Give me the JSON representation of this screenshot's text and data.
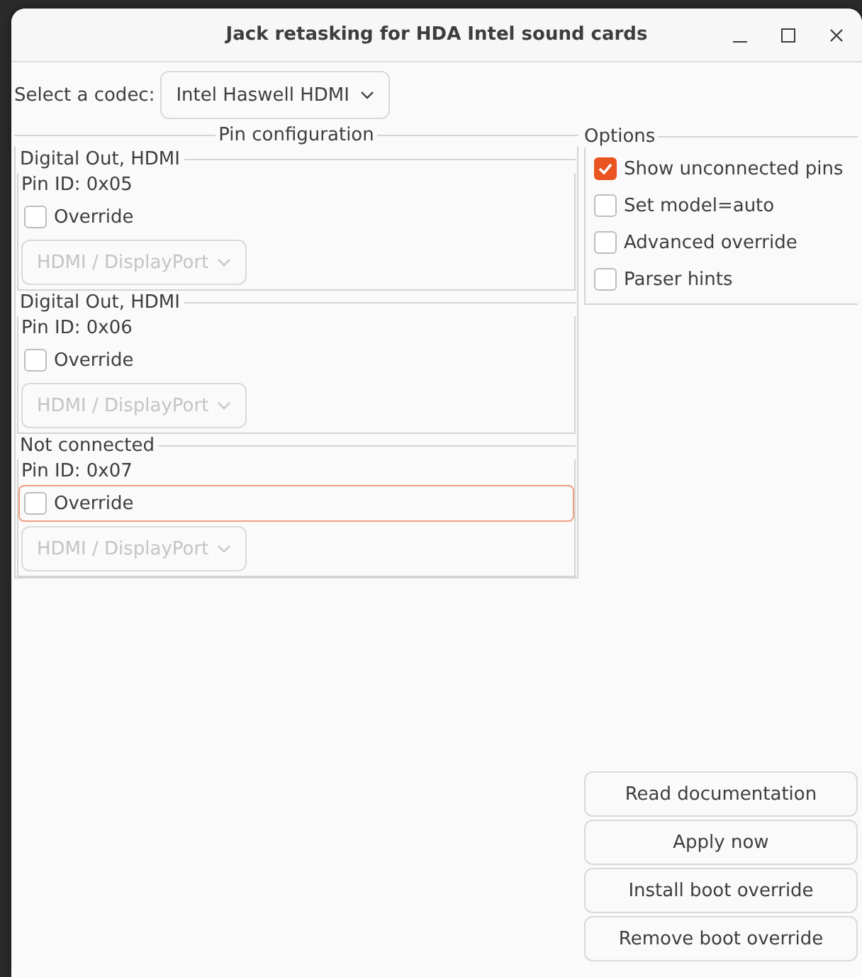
{
  "window": {
    "title": "Jack retasking for HDA Intel sound cards"
  },
  "codec": {
    "label": "Select a codec:",
    "value": "Intel Haswell HDMI"
  },
  "pin_configuration": {
    "title": "Pin configuration",
    "pins": [
      {
        "name": "Digital Out, HDMI",
        "pin_id": "Pin ID: 0x05",
        "override": {
          "label": "Override",
          "checked": false,
          "focused": false
        },
        "connection": {
          "value": "HDMI / DisplayPort",
          "disabled": true
        }
      },
      {
        "name": "Digital Out, HDMI",
        "pin_id": "Pin ID: 0x06",
        "override": {
          "label": "Override",
          "checked": false,
          "focused": false
        },
        "connection": {
          "value": "HDMI / DisplayPort",
          "disabled": true
        }
      },
      {
        "name": "Not connected",
        "pin_id": "Pin ID: 0x07",
        "override": {
          "label": "Override",
          "checked": false,
          "focused": true
        },
        "connection": {
          "value": "HDMI / DisplayPort",
          "disabled": true
        }
      }
    ]
  },
  "options": {
    "title": "Options",
    "items": [
      {
        "label": "Show unconnected pins",
        "checked": true
      },
      {
        "label": "Set model=auto",
        "checked": false
      },
      {
        "label": "Advanced override",
        "checked": false
      },
      {
        "label": "Parser hints",
        "checked": false
      }
    ]
  },
  "buttons": [
    "Read documentation",
    "Apply now",
    "Install boot override",
    "Remove boot override"
  ]
}
